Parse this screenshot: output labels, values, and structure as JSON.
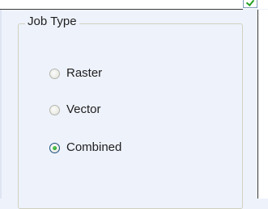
{
  "group": {
    "title": "Job Type"
  },
  "options": [
    {
      "label": "Raster",
      "selected": false
    },
    {
      "label": "Vector",
      "selected": false
    },
    {
      "label": "Combined",
      "selected": true
    }
  ],
  "top_checkbox": {
    "checked": true
  },
  "colors": {
    "background": "#eef2fb",
    "radio_dot": "#21a121",
    "check_mark": "#21a121"
  }
}
